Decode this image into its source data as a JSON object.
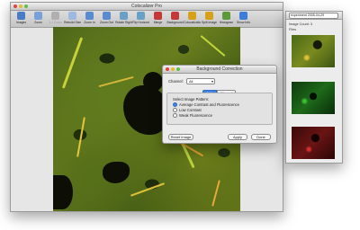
{
  "main_window": {
    "title": "Colocalizer Pro",
    "toolbar": [
      {
        "label": "Images",
        "icon": "images-icon",
        "color": "#4a7cc6",
        "enabled": true
      },
      {
        "label": "Zoom",
        "icon": "zoom-icon",
        "color": "#7aa0d8",
        "enabled": true
      },
      {
        "label": "1:1 Zoom",
        "icon": "actual-size-icon",
        "color": "#b0b0b0",
        "enabled": false
      },
      {
        "label": "Rebuild Size",
        "icon": "rebuild-size-icon",
        "color": "#9fb8e0",
        "enabled": true
      },
      {
        "label": "Zoom In",
        "icon": "zoom-in-icon",
        "color": "#5a8ad0",
        "enabled": true
      },
      {
        "label": "Zoom Out",
        "icon": "zoom-out-icon",
        "color": "#5a8ad0",
        "enabled": true
      },
      {
        "label": "Rotate Right",
        "icon": "rotate-right-icon",
        "color": "#6aa0c8",
        "enabled": true
      },
      {
        "label": "Flip Horizontal",
        "icon": "flip-horizontal-icon",
        "color": "#6aa0c8",
        "enabled": true
      },
      {
        "label": "Merge",
        "icon": "merge-icon",
        "color": "#c43838",
        "enabled": true
      },
      {
        "label": "Background",
        "icon": "background-icon",
        "color": "#c43838",
        "enabled": true
      },
      {
        "label": "Colocalization",
        "icon": "colocalization-icon",
        "color": "#d8a018",
        "enabled": true
      },
      {
        "label": "Split Image",
        "icon": "split-image-icon",
        "color": "#d8a018",
        "enabled": true
      },
      {
        "label": "Histogram",
        "icon": "histogram-icon",
        "color": "#5a9a3a",
        "enabled": true
      },
      {
        "label": "Show Info",
        "icon": "info-icon",
        "color": "#3d7cd8",
        "enabled": true
      }
    ]
  },
  "side_panel": {
    "selector_value": "experiment 2005-04-29",
    "image_count_label": "Image Count:",
    "image_count": "3",
    "files_label": "Files",
    "thumbnails": [
      "merged",
      "green",
      "red"
    ]
  },
  "dialog": {
    "title": "Background Correction",
    "channel_label": "Channel:",
    "channel_value": "All",
    "tabs": [
      "Auto",
      "Manual"
    ],
    "active_tab": "Auto",
    "group_title": "Select Image Pattern:",
    "options": [
      "Average Contrast and Fluorescence",
      "Low Contrast",
      "Weak Fluorescence"
    ],
    "selected_option": 0,
    "reset_button": "Reset Image",
    "apply_button": "Apply",
    "done_button": "Done",
    "accent": "#3d84e6"
  }
}
